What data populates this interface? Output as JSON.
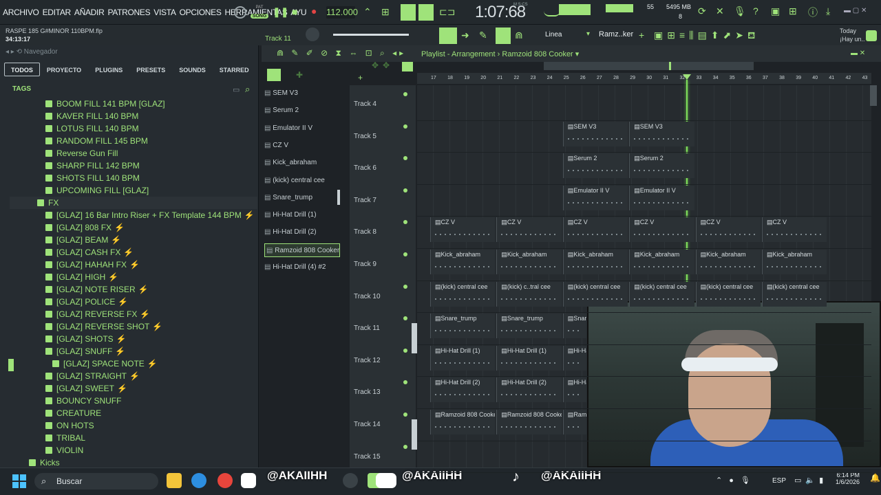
{
  "menu": [
    "ARCHIVO",
    "EDITAR",
    "AÑADIR",
    "PATRONES",
    "VISTA",
    "OPCIONES",
    "HERRAMIENTAS",
    "AYU"
  ],
  "transport": {
    "song_label": "SONG",
    "pat_label": "PAT",
    "tempo": "112.000",
    "time": "1:07:68",
    "time_unit": "M:S:CS",
    "cpu": "55",
    "ram": "5495 MB",
    "ram_sub": "8"
  },
  "project": {
    "name": "RASPE 185 G#MINOR 110BPM.flp",
    "time": "34:13:17",
    "track_hint": "Track 11",
    "snap": "Linea",
    "preset": "Ramz..ker",
    "hint_date": "Today",
    "hint_msg": "¡Hay un.."
  },
  "browser": {
    "nav_label": "Navegador",
    "tabs": [
      "TODOS",
      "PROYECTO",
      "PLUGINS",
      "PRESETS",
      "SOUNDS",
      "STARRED"
    ],
    "tags_label": "TAGS",
    "items": [
      {
        "label": "BOOM FILL 141 BPM [GLAZ]",
        "indent": 1
      },
      {
        "label": "KAVER FILL 140 BPM",
        "indent": 1
      },
      {
        "label": "LOTUS FILL 140 BPM",
        "indent": 1
      },
      {
        "label": "RANDOM FILL 145 BPM",
        "indent": 1
      },
      {
        "label": "Reverse Gun Fill",
        "indent": 1
      },
      {
        "label": "SHARP FILL 142 BPM",
        "indent": 1
      },
      {
        "label": "SHOTS FILL 140 BPM",
        "indent": 1
      },
      {
        "label": "UPCOMING FILL [GLAZ]",
        "indent": 1
      },
      {
        "label": "FX",
        "indent": 0,
        "folder": true
      },
      {
        "label": "[GLAZ] 16 Bar Intro Riser + FX Template 144 BPM",
        "indent": 1,
        "bolt": true
      },
      {
        "label": "[GLAZ] 808 FX",
        "indent": 1,
        "bolt": true
      },
      {
        "label": "[GLAZ] BEAM",
        "indent": 1,
        "bolt": true
      },
      {
        "label": "[GLAZ] CASH FX",
        "indent": 1,
        "bolt": true
      },
      {
        "label": "[GLAZ] HAHAH FX",
        "indent": 1,
        "bolt": true
      },
      {
        "label": "[GLAZ] HIGH",
        "indent": 1,
        "bolt": true
      },
      {
        "label": "[GLAZ] NOTE RISER",
        "indent": 1,
        "bolt": true
      },
      {
        "label": "[GLAZ] POLICE",
        "indent": 1,
        "bolt": true
      },
      {
        "label": "[GLAZ] REVERSE FX",
        "indent": 1,
        "bolt": true
      },
      {
        "label": "[GLAZ] REVERSE SHOT",
        "indent": 1,
        "bolt": true
      },
      {
        "label": "[GLAZ] SHOTS",
        "indent": 1,
        "bolt": true
      },
      {
        "label": "[GLAZ] SNUFF",
        "indent": 1,
        "bolt": true
      },
      {
        "label": "[GLAZ] SPACE NOTE",
        "indent": 2,
        "bolt": true
      },
      {
        "label": "[GLAZ] STRAIGHT",
        "indent": 1,
        "bolt": true
      },
      {
        "label": "[GLAZ] SWEET",
        "indent": 1,
        "bolt": true
      },
      {
        "label": "BOUNCY SNUFF",
        "indent": 1
      },
      {
        "label": "CREATURE",
        "indent": 1
      },
      {
        "label": "ON HOTS",
        "indent": 1
      },
      {
        "label": "TRIBAL",
        "indent": 1
      },
      {
        "label": "VIOLIN",
        "indent": 1
      },
      {
        "label": "Kicks",
        "indent": 0,
        "folder": true
      }
    ]
  },
  "channels": [
    "SEM V3",
    "Serum 2",
    "Emulator II V",
    "CZ V",
    "Kick_abraham",
    "(kick) central cee",
    "Snare_trump",
    "Hi-Hat Drill (1)",
    "Hi-Hat Drill (2)",
    "Ramzoid 808 Cooker",
    "Hi-Hat Drill (4) #2"
  ],
  "selected_channel": "Ramzoid 808 Cooker",
  "playlist": {
    "title": "Playlist - Arrangement",
    "pattern": "Ramzoid 808 Cooker",
    "ruler": [
      "17",
      "18",
      "19",
      "20",
      "21",
      "22",
      "23",
      "24",
      "25",
      "26",
      "27",
      "28",
      "29",
      "30",
      "31",
      "32",
      "33",
      "34",
      "35",
      "36",
      "37",
      "38",
      "39",
      "40",
      "41",
      "42",
      "43"
    ],
    "tracks": [
      "Track 4",
      "Track 5",
      "Track 6",
      "Track 7",
      "Track 8",
      "Track 9",
      "Track 10",
      "Track 11",
      "Track 12",
      "Track 13",
      "Track 14",
      "Track 15"
    ],
    "clips": [
      {
        "track": 1,
        "bar": 25,
        "label": "SEM V3"
      },
      {
        "track": 1,
        "bar": 29,
        "label": "SEM V3"
      },
      {
        "track": 2,
        "bar": 25,
        "label": "Serum 2"
      },
      {
        "track": 2,
        "bar": 29,
        "label": "Serum 2"
      },
      {
        "track": 3,
        "bar": 25,
        "label": "Emulator II V"
      },
      {
        "track": 3,
        "bar": 29,
        "label": "Emulator II V"
      },
      {
        "track": 4,
        "bar": 17,
        "label": "CZ V"
      },
      {
        "track": 4,
        "bar": 21,
        "label": "CZ V"
      },
      {
        "track": 4,
        "bar": 25,
        "label": "CZ V"
      },
      {
        "track": 4,
        "bar": 29,
        "label": "CZ V"
      },
      {
        "track": 4,
        "bar": 33,
        "label": "CZ V"
      },
      {
        "track": 4,
        "bar": 37,
        "label": "CZ V"
      },
      {
        "track": 5,
        "bar": 17,
        "label": "Kick_abraham"
      },
      {
        "track": 5,
        "bar": 21,
        "label": "Kick_abraham"
      },
      {
        "track": 5,
        "bar": 25,
        "label": "Kick_abraham"
      },
      {
        "track": 5,
        "bar": 29,
        "label": "Kick_abraham"
      },
      {
        "track": 5,
        "bar": 33,
        "label": "Kick_abraham"
      },
      {
        "track": 5,
        "bar": 37,
        "label": "Kick_abraham"
      },
      {
        "track": 6,
        "bar": 17,
        "label": "(kick) central cee"
      },
      {
        "track": 6,
        "bar": 21,
        "label": "(kick) c..tral cee"
      },
      {
        "track": 6,
        "bar": 25,
        "label": "(kick) central cee"
      },
      {
        "track": 6,
        "bar": 29,
        "label": "(kick) central cee"
      },
      {
        "track": 6,
        "bar": 33,
        "label": "(kick) central cee"
      },
      {
        "track": 6,
        "bar": 37,
        "label": "(kick) central cee"
      },
      {
        "track": 7,
        "bar": 17,
        "label": "Snare_trump"
      },
      {
        "track": 7,
        "bar": 21,
        "label": "Snare_trump"
      },
      {
        "track": 7,
        "bar": 25,
        "label": "Snare"
      },
      {
        "track": 8,
        "bar": 17,
        "label": "Hi-Hat Drill (1)"
      },
      {
        "track": 8,
        "bar": 21,
        "label": "Hi-Hat Drill (1)"
      },
      {
        "track": 8,
        "bar": 25,
        "label": "Hi-Ha"
      },
      {
        "track": 9,
        "bar": 17,
        "label": "Hi-Hat Drill (2)"
      },
      {
        "track": 9,
        "bar": 21,
        "label": "Hi-Hat Drill (2)"
      },
      {
        "track": 9,
        "bar": 25,
        "label": "Hi-Ha"
      },
      {
        "track": 10,
        "bar": 17,
        "label": "Ramzoid 808 Cooker"
      },
      {
        "track": 10,
        "bar": 21,
        "label": "Ramzoid 808 Cooker"
      },
      {
        "track": 10,
        "bar": 25,
        "label": "Ramzo"
      }
    ]
  },
  "taskbar": {
    "search_placeholder": "Buscar",
    "overlay_handles": [
      "@AKAIIHH",
      "@AKAIIHH",
      "@AKAIIHH"
    ],
    "lang": "ESP",
    "time": "6:14 PM",
    "date": "1/6/2026"
  },
  "colors": {
    "accent": "#9fe37a",
    "playhead": "#7fe05a",
    "bg": "#262b2f"
  }
}
